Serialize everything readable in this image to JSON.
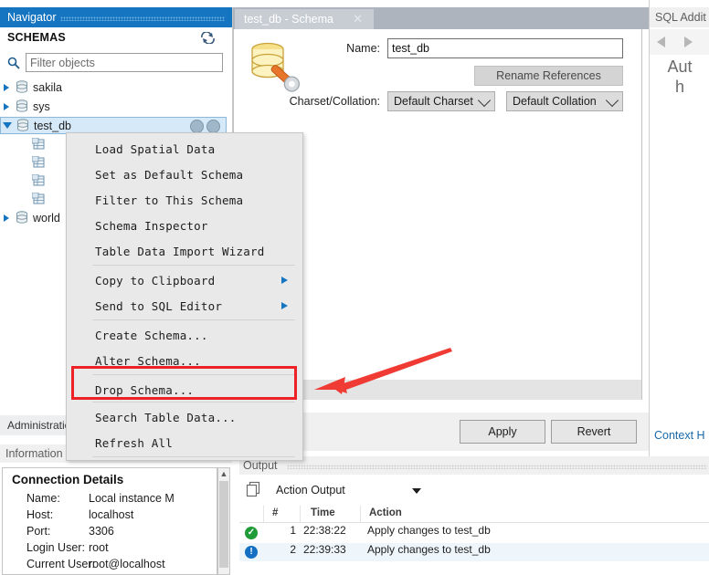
{
  "navigator": {
    "title": "Navigator",
    "schemas_label": "SCHEMAS",
    "refresh_icon": "refresh-icon",
    "search_icon": "search-icon",
    "filter_placeholder": "Filter objects",
    "filter_value": "",
    "tree": [
      {
        "label": "sakila",
        "type": "schema",
        "expanded": false,
        "indent": 0
      },
      {
        "label": "sys",
        "type": "schema",
        "expanded": false,
        "indent": 0
      },
      {
        "label": "test_db",
        "type": "schema",
        "expanded": true,
        "indent": 0,
        "selected": true
      },
      {
        "label": "",
        "type": "table",
        "indent": 1
      },
      {
        "label": "",
        "type": "table",
        "indent": 1
      },
      {
        "label": "",
        "type": "table",
        "indent": 1
      },
      {
        "label": "",
        "type": "table",
        "indent": 1
      },
      {
        "label": "world",
        "type": "schema",
        "expanded": false,
        "indent": 0
      }
    ]
  },
  "left_tabs": {
    "administration": "Administration"
  },
  "information": {
    "title": "Information",
    "heading": "Connection Details",
    "rows": [
      {
        "key": "Name:",
        "value": "Local instance M"
      },
      {
        "key": "Host:",
        "value": "localhost"
      },
      {
        "key": "Port:",
        "value": "3306"
      },
      {
        "key": "Login User:",
        "value": "root"
      },
      {
        "key": "Current User:",
        "value": "root@localhost"
      }
    ]
  },
  "context_menu": {
    "items": [
      {
        "label": "Load Spatial Data",
        "submenu": false,
        "separator_after": false
      },
      {
        "label": "Set as Default Schema",
        "submenu": false,
        "separator_after": false
      },
      {
        "label": "Filter to This Schema",
        "submenu": false,
        "separator_after": false
      },
      {
        "label": "Schema Inspector",
        "submenu": false,
        "separator_after": false
      },
      {
        "label": "Table Data Import Wizard",
        "submenu": false,
        "separator_after": true
      },
      {
        "label": "Copy to Clipboard",
        "submenu": true,
        "separator_after": false
      },
      {
        "label": "Send to SQL Editor",
        "submenu": true,
        "separator_after": true
      },
      {
        "label": "Create Schema...",
        "submenu": false,
        "separator_after": false
      },
      {
        "label": "Alter Schema...",
        "submenu": false,
        "separator_after": true
      },
      {
        "label": "Drop Schema...",
        "submenu": false,
        "separator_after": true,
        "highlighted": true
      },
      {
        "label": "Search Table Data...",
        "submenu": false,
        "separator_after": false
      },
      {
        "label": "Refresh All",
        "submenu": false,
        "separator_after": true
      }
    ]
  },
  "editor": {
    "tab_label": "test_db - Schema",
    "tab_close_icon": "close-icon",
    "schema_icon": "schema-database-icon",
    "name_label": "Name:",
    "name_value": "test_db",
    "rename_references_label": "Rename References",
    "charset_label": "Charset/Collation:",
    "charset_value": "Default Charset",
    "collation_value": "Default Collation",
    "apply_label": "Apply",
    "revert_label": "Revert"
  },
  "sql_additions": {
    "title": "SQL Addit",
    "prev_icon": "nav-prev-icon",
    "next_icon": "nav-next-icon",
    "help_line1": "Aut",
    "help_line2": "h",
    "context_help_link": "Context H"
  },
  "output": {
    "title": "Output",
    "copy_icon": "copy-icon",
    "type_selected": "Action Output",
    "columns": [
      "#",
      "Time",
      "Action"
    ],
    "rows": [
      {
        "status": "ok",
        "num": "1",
        "time": "22:38:22",
        "action": "Apply changes to test_db"
      },
      {
        "status": "info",
        "num": "2",
        "time": "22:39:33",
        "action": "Apply changes to test_db"
      }
    ]
  },
  "annotations": {
    "highlight_color": "#ec2227",
    "arrow_color": "#f03b34"
  }
}
